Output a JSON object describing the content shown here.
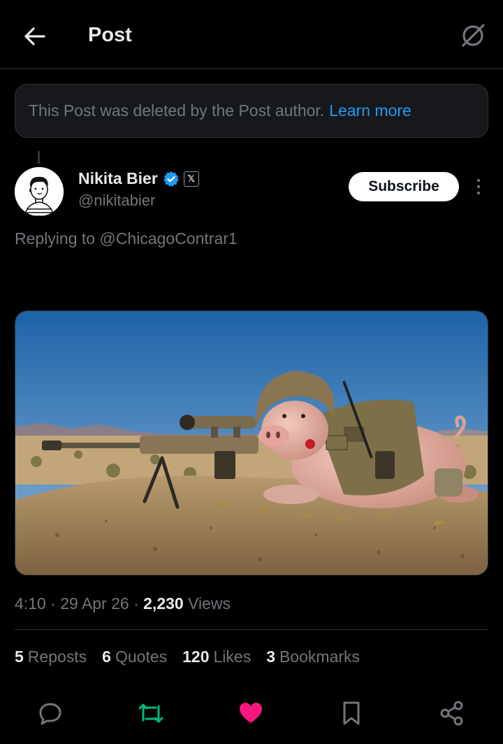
{
  "header": {
    "title": "Post",
    "back_icon": "arrow-left-icon",
    "grok_icon": "grok-icon"
  },
  "deleted_notice": {
    "text": "This Post was deleted by the Post author.",
    "link": "Learn more"
  },
  "author": {
    "name": "Nikita Bier",
    "handle": "@nikitabier",
    "verified": true,
    "affiliation_badge": "𝕏",
    "subscribe_label": "Subscribe"
  },
  "reply": {
    "prefix": "Replying to",
    "mention": "@ChicagoContrar1"
  },
  "meta": {
    "time": "4:10",
    "sep1": "·",
    "date": "29 Apr 26",
    "sep2": "·",
    "views_count": "2,230",
    "views_label": "Views"
  },
  "stats": [
    {
      "count": "5",
      "label": "Reposts"
    },
    {
      "count": "6",
      "label": "Quotes"
    },
    {
      "count": "120",
      "label": "Likes"
    },
    {
      "count": "3",
      "label": "Bookmarks"
    }
  ],
  "actions": [
    {
      "name": "reply-icon"
    },
    {
      "name": "repost-icon",
      "active": true,
      "color": "#00ba7c"
    },
    {
      "name": "like-icon",
      "active": true,
      "color": "#f91880"
    },
    {
      "name": "bookmark-icon"
    },
    {
      "name": "share-icon"
    }
  ],
  "colors": {
    "accent": "#1d9bf0",
    "muted": "#71767b",
    "repost": "#00ba7c",
    "like": "#f91880"
  }
}
